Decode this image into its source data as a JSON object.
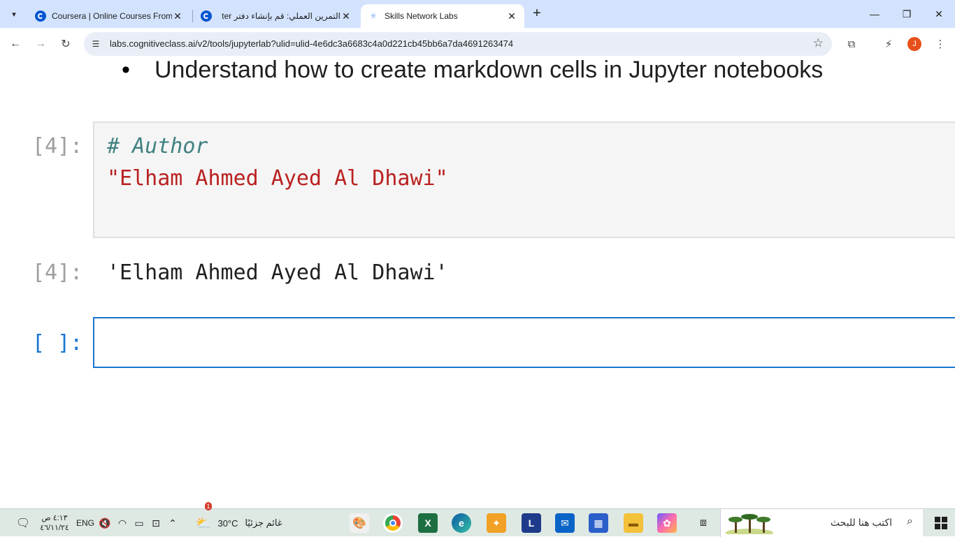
{
  "browser": {
    "tabs": [
      {
        "title": "Coursera | Online Courses From",
        "favicon": "coursera-icon",
        "active": false
      },
      {
        "title": "التمرين العملي: قم بإنشاء دفتر ter",
        "favicon": "coursera-icon",
        "active": false
      },
      {
        "title": "Skills Network Labs",
        "favicon": "skills-network-icon",
        "active": true
      }
    ],
    "new_tab": "+",
    "url": "labs.cognitiveclass.ai/v2/tools/jupyterlab?ulid=ulid-4e6dc3a6683c4a0d221cb45bb6a7da4691263474",
    "profile_initial": "J"
  },
  "notebook": {
    "markdown_bullet": "•",
    "markdown_text": "Understand how to create markdown cells in Jupyter notebooks",
    "code_cell": {
      "prompt": "[4]:",
      "line1": "# Author",
      "line2": "\"Elham Ahmed Ayed Al Dhawi\""
    },
    "output": {
      "prompt": "[4]:",
      "text": "'Elham Ahmed Ayed Al Dhawi'"
    },
    "empty_cell": {
      "prompt": "[ ]:"
    }
  },
  "taskbar": {
    "time": "٤:١٣ ص",
    "date": "٤٦/١١/٢٤",
    "language": "ENG",
    "weather_temp": "30°C",
    "weather_desc": "غائم جزئيًا",
    "weather_badge": "1",
    "search_placeholder": "اكتب هنا للبحث",
    "apps": [
      "paint-icon",
      "chrome-icon",
      "excel-icon",
      "edge-icon",
      "app-icon",
      "L-icon",
      "outlook-icon",
      "store-icon",
      "file-explorer-icon",
      "copilot-icon",
      "task-view-icon"
    ]
  },
  "colors": {
    "tabbar": "#d3e3fd",
    "active_prompt": "#1976d2",
    "comment": "#408080",
    "string": "#ba2121"
  }
}
